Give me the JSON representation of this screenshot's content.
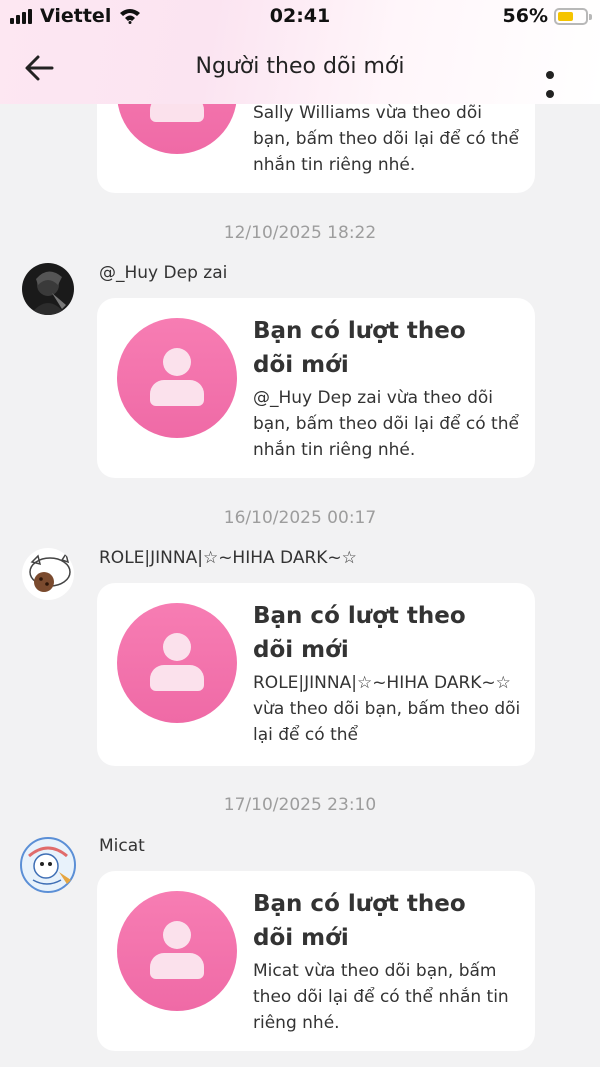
{
  "status_bar": {
    "carrier": "Viettel",
    "time": "02:41",
    "battery_percent": "56%",
    "battery_level": 0.56,
    "battery_color": "#f5c400"
  },
  "nav": {
    "back_icon": "arrow-left-icon",
    "title": "Người theo dõi mới",
    "more_icon": "more-dots-icon"
  },
  "accent_color": "#f077ae",
  "messages": [
    {
      "text": "Sally Williams vừa theo dõi bạn, bấm theo dõi lại để có thể nhắn tin riêng nhé."
    },
    {
      "timestamp": "12/10/2025 18:22",
      "sender": "@_Huy Dep zai",
      "title": "Bạn có lượt theo dõi mới",
      "text": "@_Huy Dep zai vừa theo dõi bạn, bấm theo dõi lại để có thể nhắn tin riêng nhé."
    },
    {
      "timestamp": "16/10/2025 00:17",
      "sender": "ROLE|JINNA|☆~HIHA DARK~☆",
      "title": "Bạn có lượt theo dõi mới",
      "text": "ROLE|JINNA|☆~HIHA DARK~☆ vừa theo dõi bạn, bấm theo dõi lại để có thể"
    },
    {
      "timestamp": "17/10/2025 23:10",
      "sender": "Micat",
      "title": "Bạn có lượt theo dõi mới",
      "text": "Micat vừa theo dõi bạn, bấm theo dõi lại để có thể nhắn tin riêng nhé."
    }
  ]
}
